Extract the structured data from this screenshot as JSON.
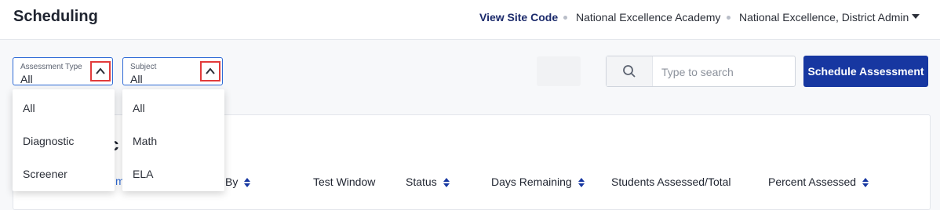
{
  "header": {
    "title": "Scheduling",
    "site_code_label": "View Site Code",
    "school": "National Excellence Academy",
    "user": "National Excellence, District Admin"
  },
  "filters": {
    "assessment_type": {
      "label": "Assessment Type",
      "value": "All",
      "options": [
        "All",
        "Diagnostic",
        "Screener"
      ]
    },
    "subject": {
      "label": "Subject",
      "value": "All",
      "options": [
        "All",
        "Math",
        "ELA"
      ]
    }
  },
  "search": {
    "placeholder": "Type to search"
  },
  "actions": {
    "schedule_label": "Schedule Assessment"
  },
  "table": {
    "title_fragment": "ic",
    "link_fragment": "m",
    "columns": [
      "By",
      "Test Window",
      "Status",
      "Days Remaining",
      "Students Assessed/Total",
      "Percent Assessed"
    ]
  },
  "colors": {
    "primary": "#1737a1",
    "highlight": "#e23b3b",
    "focus": "#2f6bd6"
  }
}
